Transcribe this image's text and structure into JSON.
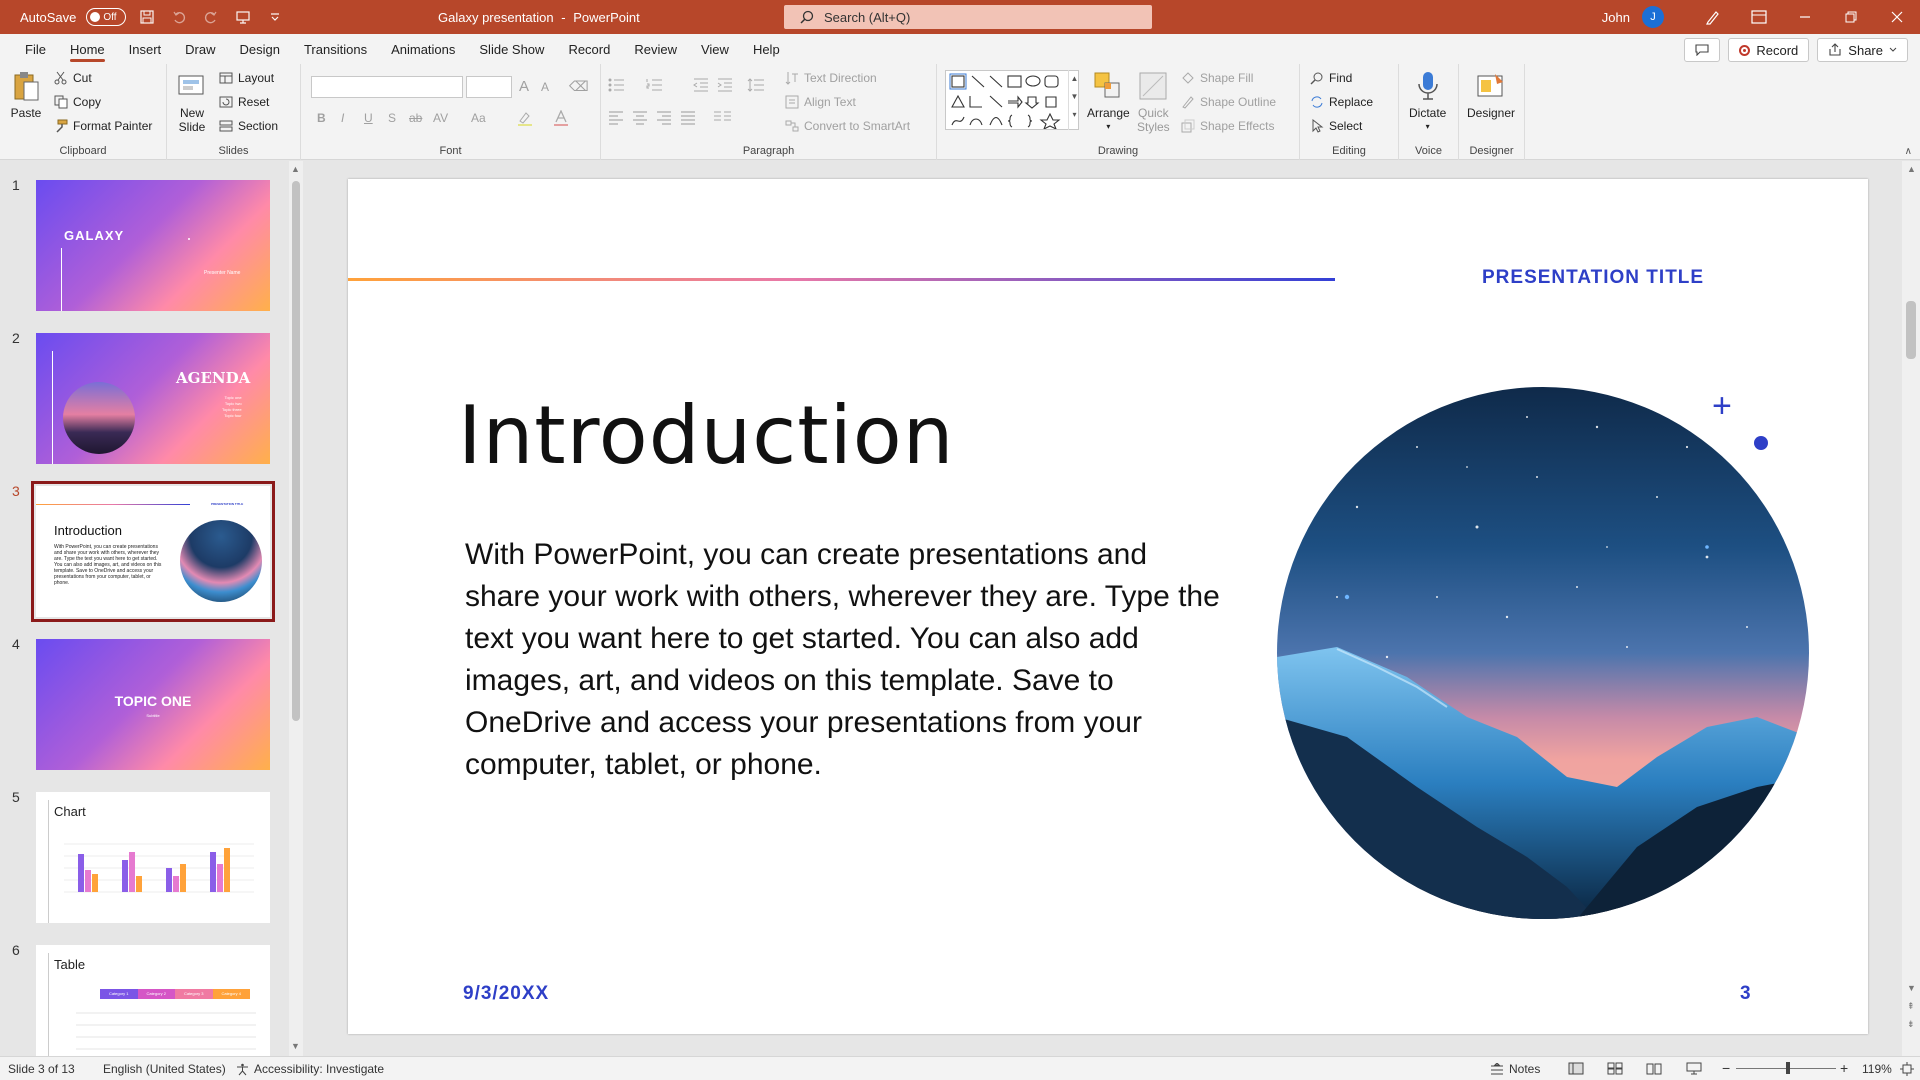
{
  "titlebar": {
    "autosave_label": "AutoSave",
    "autosave_state": "Off",
    "doc_title": "Galaxy presentation",
    "separator": "-",
    "app_name": "PowerPoint",
    "search_placeholder": "Search (Alt+Q)",
    "user_name": "John",
    "user_initial": "J"
  },
  "menu": {
    "tabs": [
      "File",
      "Home",
      "Insert",
      "Draw",
      "Design",
      "Transitions",
      "Animations",
      "Slide Show",
      "Record",
      "Review",
      "View",
      "Help"
    ],
    "active_tab": "Home",
    "record_label": "Record",
    "share_label": "Share"
  },
  "ribbon": {
    "clipboard": {
      "label": "Clipboard",
      "paste": "Paste",
      "cut": "Cut",
      "copy": "Copy",
      "format_painter": "Format Painter"
    },
    "slides": {
      "label": "Slides",
      "new_slide_1": "New",
      "new_slide_2": "Slide",
      "layout": "Layout",
      "reset": "Reset",
      "section": "Section"
    },
    "font": {
      "label": "Font",
      "bold": "B",
      "italic": "I",
      "underline": "U",
      "strike": "S",
      "strike2": "ab",
      "spacing": "AV",
      "case": "Aa",
      "grow": "A",
      "shrink": "A"
    },
    "paragraph": {
      "label": "Paragraph",
      "text_direction": "Text Direction",
      "align_text": "Align Text",
      "convert_smartart": "Convert to SmartArt"
    },
    "drawing": {
      "label": "Drawing",
      "arrange": "Arrange",
      "quick_styles_1": "Quick",
      "quick_styles_2": "Styles",
      "shape_fill": "Shape Fill",
      "shape_outline": "Shape Outline",
      "shape_effects": "Shape Effects"
    },
    "editing": {
      "label": "Editing",
      "find": "Find",
      "replace": "Replace",
      "select": "Select"
    },
    "voice": {
      "label": "Voice",
      "dictate": "Dictate"
    },
    "designer": {
      "label": "Designer",
      "designer": "Designer"
    }
  },
  "thumbnails": [
    {
      "num": "1",
      "title": "GALAXY",
      "sub": "Presenter Name"
    },
    {
      "num": "2",
      "title": "AGENDA",
      "items": [
        "Topic one",
        "Topic two",
        "Topic three",
        "Topic four"
      ]
    },
    {
      "num": "3",
      "title": "Introduction",
      "header": "PRESENTATION TITLE",
      "body": "With PowerPoint, you can create presentations and share your work with others, wherever they are. Type the text you want here to get started. You can also add images, art, and videos on this template. Save to OneDrive and access your presentations from your computer, tablet, or phone."
    },
    {
      "num": "4",
      "title": "TOPIC ONE",
      "sub": "Subtitle"
    },
    {
      "num": "5",
      "title": "Chart"
    },
    {
      "num": "6",
      "title": "Table",
      "cols": [
        "Category 1",
        "Category 2",
        "Category 3",
        "Category 4"
      ]
    }
  ],
  "slide": {
    "header": "PRESENTATION TITLE",
    "title": "Introduction",
    "body": "With PowerPoint, you can create presentations and share your work with others, wherever they are. Type the text you want here to get started. You can also add images, art, and videos on this template. Save to OneDrive and access your presentations from your computer, tablet, or phone.",
    "date": "9/3/20XX",
    "page": "3",
    "plus": "+"
  },
  "status": {
    "slide_count": "Slide 3 of 13",
    "language": "English (United States)",
    "accessibility": "Accessibility: Investigate",
    "notes": "Notes",
    "zoom": "119%"
  },
  "colors": {
    "brand": "#b7472a",
    "accent_blue": "#2e3fc7"
  }
}
